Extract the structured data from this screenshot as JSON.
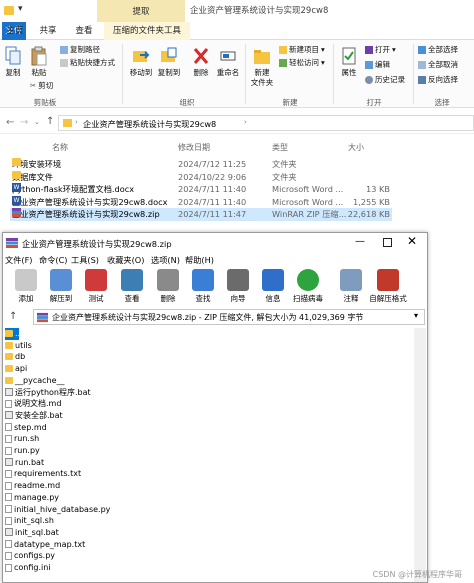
{
  "explorer": {
    "window_title": "企业资产管理系统设计与实现29cw8",
    "context_tab_header": "提取",
    "tabs": [
      "主页",
      "共享",
      "查看",
      "压缩的文件夹工具"
    ],
    "ribbon": {
      "clipboard": {
        "copy": "复制",
        "paste": "粘贴",
        "copy_path": "复制路径",
        "paste_shortcut": "粘贴快捷方式",
        "cut": "剪切",
        "group": "剪贴板"
      },
      "organize": {
        "move_to": "移动到",
        "copy_to": "复制到",
        "delete": "删除",
        "rename": "重命名",
        "group": "组织"
      },
      "new": {
        "new_folder": "新建\n文件夹",
        "new_item": "新建项目",
        "easy_access": "轻松访问",
        "group": "新建"
      },
      "open": {
        "properties": "属性",
        "open": "打开",
        "edit": "编辑",
        "history": "历史记录",
        "group": "打开"
      },
      "select": {
        "select_all": "全部选择",
        "select_none": "全部取消",
        "invert": "反向选择",
        "group": "选择"
      }
    },
    "address": "企业资产管理系统设计与实现29cw8",
    "columns": [
      "名称",
      "修改日期",
      "类型",
      "大小"
    ],
    "files": [
      {
        "name": "环境安装环境",
        "date": "2024/7/12 11:25",
        "type": "文件夹",
        "size": "",
        "icon": "folder-icon"
      },
      {
        "name": "数据库文件",
        "date": "2024/10/22 9:06",
        "type": "文件夹",
        "size": "",
        "icon": "folder-icon"
      },
      {
        "name": "python-flask环境配置文档.docx",
        "date": "2024/7/11 11:40",
        "type": "Microsoft Word ...",
        "size": "13 KB",
        "icon": "word-icon"
      },
      {
        "name": "企业资产管理系统设计与实现29cw8.docx",
        "date": "2024/7/11 11:40",
        "type": "Microsoft Word ...",
        "size": "1,255 KB",
        "icon": "word-icon"
      },
      {
        "name": "企业资产管理系统设计与实现29cw8.zip",
        "date": "2024/7/11 11:47",
        "type": "WinRAR ZIP 压缩...",
        "size": "22,618 KB",
        "icon": "winrar-icon"
      }
    ]
  },
  "winrar": {
    "title": "企业资产管理系统设计与实现29cw8.zip",
    "menus": [
      "文件(F)",
      "命令(C)",
      "工具(S)",
      "收藏夹(O)",
      "选项(N)",
      "帮助(H)"
    ],
    "toolbar": [
      "添加",
      "解压到",
      "测试",
      "查看",
      "删除",
      "查找",
      "向导",
      "信息",
      "扫描病毒",
      "注释",
      "自解压格式"
    ],
    "path": "企业资产管理系统设计与实现29cw8.zip - ZIP 压缩文件, 解包大小为 41,029,369 字节",
    "entries": [
      {
        "name": "..",
        "icon": "folder-icon"
      },
      {
        "name": "utils",
        "icon": "folder-icon"
      },
      {
        "name": "db",
        "icon": "folder-icon"
      },
      {
        "name": "api",
        "icon": "folder-icon"
      },
      {
        "name": "__pycache__",
        "icon": "folder-icon"
      },
      {
        "name": "运行python程序.bat",
        "icon": "bat-icon"
      },
      {
        "name": "说明文档.md",
        "icon": "file-icon"
      },
      {
        "name": "安装全部.bat",
        "icon": "bat-icon"
      },
      {
        "name": "step.md",
        "icon": "file-icon"
      },
      {
        "name": "run.sh",
        "icon": "file-icon"
      },
      {
        "name": "run.py",
        "icon": "file-icon"
      },
      {
        "name": "run.bat",
        "icon": "bat-icon"
      },
      {
        "name": "requirements.txt",
        "icon": "file-icon"
      },
      {
        "name": "readme.md",
        "icon": "file-icon"
      },
      {
        "name": "manage.py",
        "icon": "file-icon"
      },
      {
        "name": "initial_hive_database.py",
        "icon": "file-icon"
      },
      {
        "name": "init_sql.sh",
        "icon": "file-icon"
      },
      {
        "name": "init_sql.bat",
        "icon": "bat-icon"
      },
      {
        "name": "datatype_map.txt",
        "icon": "file-icon"
      },
      {
        "name": "configs.py",
        "icon": "file-icon"
      },
      {
        "name": "config.ini",
        "icon": "file-icon"
      }
    ]
  },
  "watermark": "CSDN @计算机程序华哥",
  "colors": {
    "folder": "#f5c542",
    "accent": "#0078d7",
    "selection": "#cde8ff",
    "context_tab": "#f5e7b1"
  }
}
